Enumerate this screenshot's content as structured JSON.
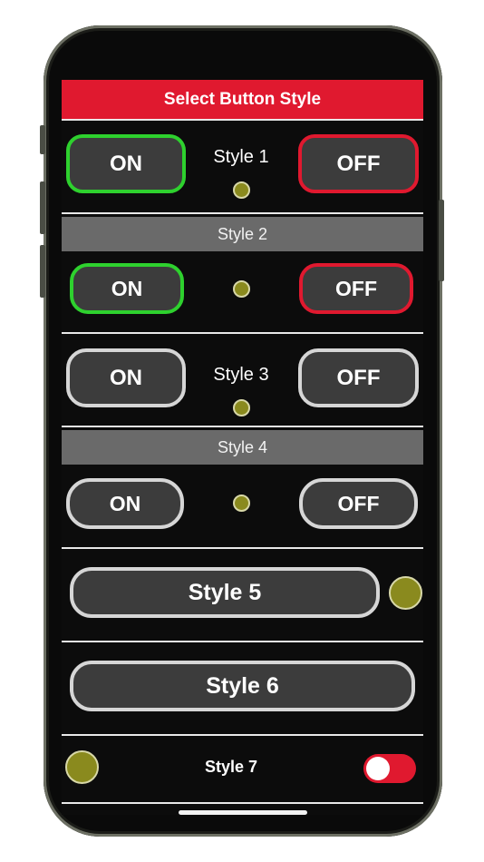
{
  "header": {
    "title": "Select Button Style"
  },
  "style1": {
    "on_label": "ON",
    "name": "Style 1",
    "off_label": "OFF"
  },
  "style2": {
    "section_title": "Style 2",
    "on_label": "ON",
    "off_label": "OFF"
  },
  "style3": {
    "on_label": "ON",
    "name": "Style 3",
    "off_label": "OFF"
  },
  "style4": {
    "section_title": "Style 4",
    "on_label": "ON",
    "off_label": "OFF"
  },
  "style5": {
    "button_label": "Style 5"
  },
  "style6": {
    "button_label": "Style 6"
  },
  "style7": {
    "name": "Style 7",
    "toggle_on": true
  },
  "colors": {
    "title_bar": "#e0192f",
    "on_border": "#2ed12e",
    "off_border": "#e0192f",
    "neutral_border": "#d6d6d6",
    "indicator": "#8a8a1e",
    "section_bar": "#6a6a6a"
  }
}
